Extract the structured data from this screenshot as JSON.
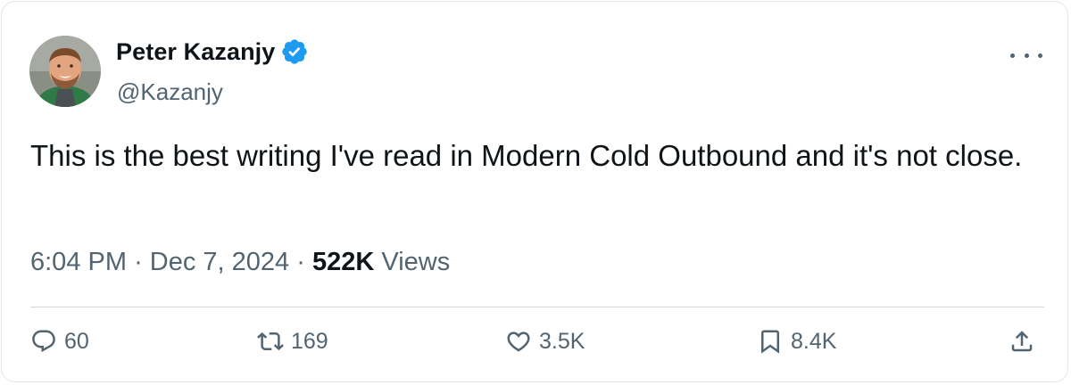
{
  "author": {
    "name": "Peter Kazanjy",
    "handle": "@Kazanjy",
    "verified": true,
    "avatar_icon": "profile-photo"
  },
  "tweet": {
    "text": "This is the best writing I've read in Modern Cold Outbound and it's not close."
  },
  "meta": {
    "time": "6:04 PM",
    "separator": "·",
    "date": "Dec 7, 2024",
    "views_count": "522K",
    "views_label": "Views"
  },
  "actions": {
    "replies": "60",
    "reposts": "169",
    "likes": "3.5K",
    "bookmarks": "8.4K"
  },
  "icons": {
    "verified": "verified-badge-icon",
    "more": "more-options-icon",
    "reply": "reply-icon",
    "repost": "repost-icon",
    "like": "like-icon",
    "bookmark": "bookmark-icon",
    "share": "share-icon"
  },
  "colors": {
    "verified_blue": "#1d9bf0",
    "text_primary": "#0f1419",
    "text_secondary": "#536471",
    "border": "#e1e8ed"
  }
}
